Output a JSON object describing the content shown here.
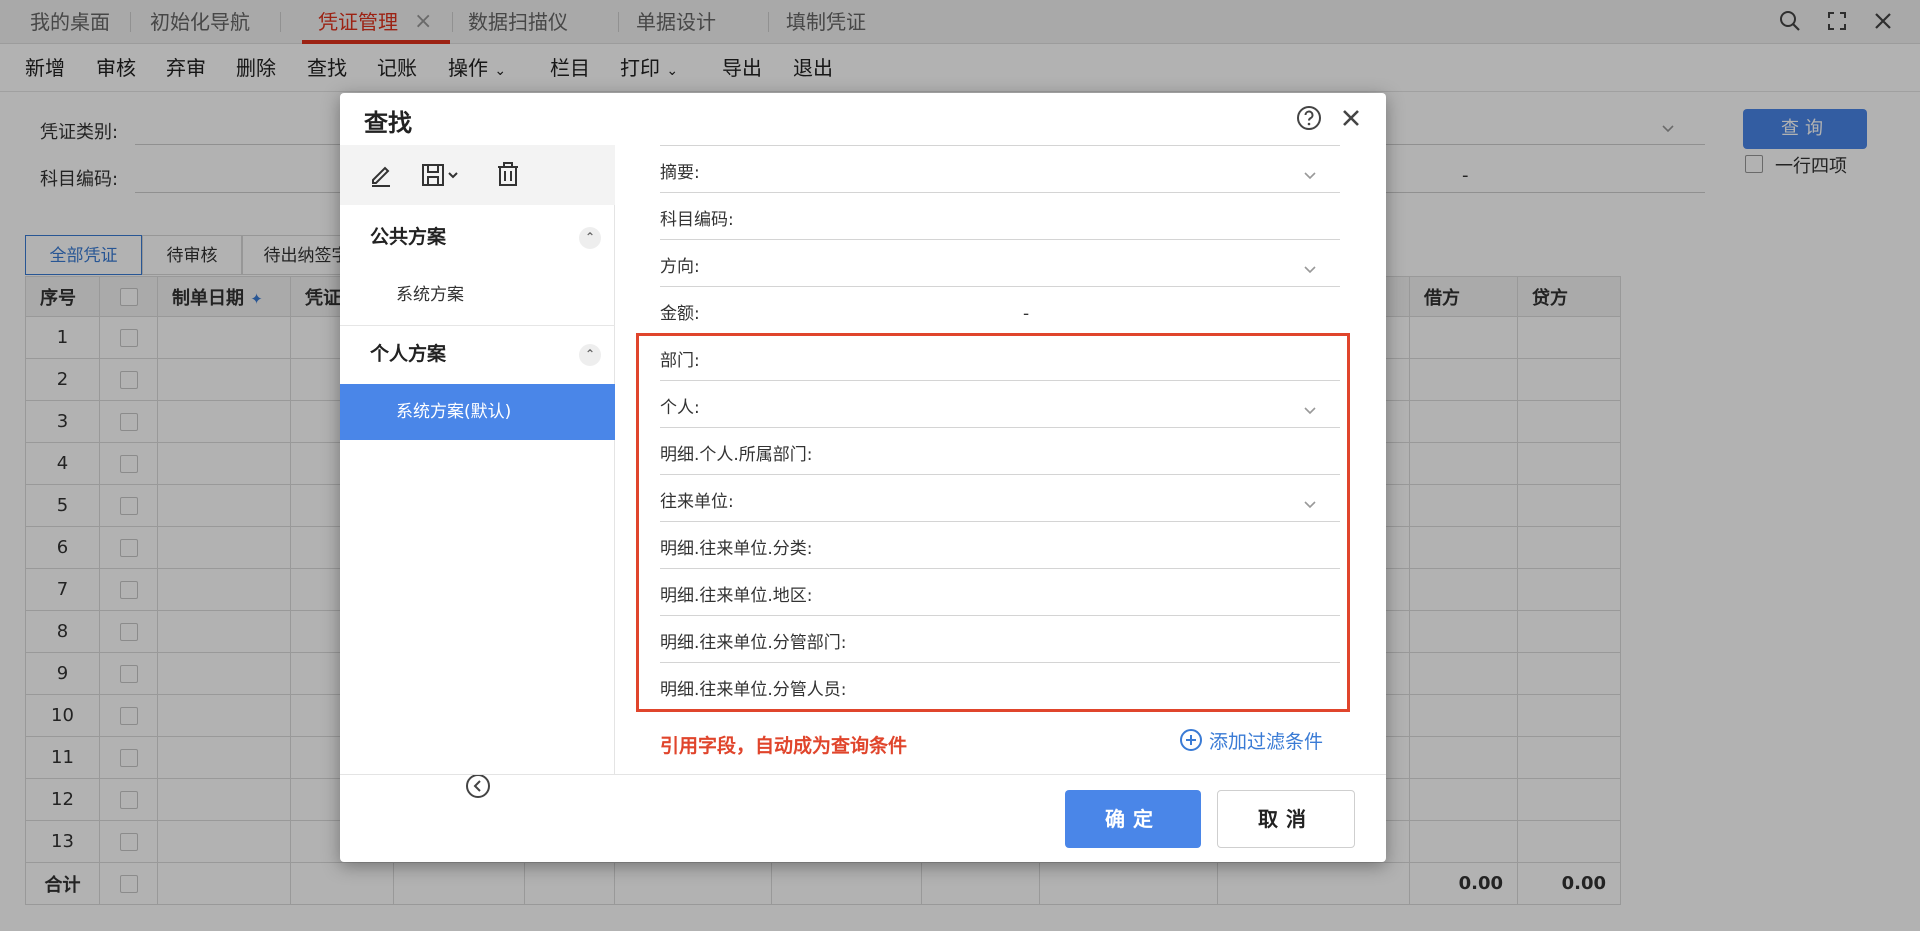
{
  "tabs": [
    {
      "label": "我的桌面"
    },
    {
      "label": "初始化导航"
    },
    {
      "label": "凭证管理"
    },
    {
      "label": "数据扫描仪"
    },
    {
      "label": "单据设计"
    },
    {
      "label": "填制凭证"
    }
  ],
  "toolbar": {
    "items": [
      "新增",
      "审核",
      "弃审",
      "删除",
      "查找",
      "记账",
      "操作",
      "栏目",
      "打印",
      "导出",
      "退出"
    ]
  },
  "filters": {
    "voucher_type_label": "凭证类别:",
    "account_code_label": "科目编码:",
    "range_dash": "-",
    "query_button": "查询",
    "one_row_four_label": "一行四项"
  },
  "view_tabs": [
    "全部凭证",
    "待审核",
    "待出纳签字"
  ],
  "grid": {
    "columns": [
      "序号",
      "",
      "制单日期",
      "凭证",
      "借方",
      "贷方"
    ],
    "rows": [
      "1",
      "2",
      "3",
      "4",
      "5",
      "6",
      "7",
      "8",
      "9",
      "10",
      "11",
      "12",
      "13"
    ],
    "total_label": "合计",
    "total_debit": "0.00",
    "total_credit": "0.00"
  },
  "dialog": {
    "title": "查找",
    "groups": {
      "public": {
        "label": "公共方案",
        "schemes": [
          "系统方案"
        ]
      },
      "personal": {
        "label": "个人方案",
        "schemes": [
          "系统方案(默认)"
        ]
      }
    },
    "fields": [
      {
        "label": "摘要:",
        "dropdown": true
      },
      {
        "label": "科目编码:",
        "dropdown": false
      },
      {
        "label": "方向:",
        "dropdown": true
      },
      {
        "label": "金额:",
        "dropdown": false,
        "range_dash": "-"
      },
      {
        "label": "部门:",
        "dropdown": false
      },
      {
        "label": "个人:",
        "dropdown": true
      },
      {
        "label": "明细.个人.所属部门:",
        "dropdown": false
      },
      {
        "label": "往来单位:",
        "dropdown": true
      },
      {
        "label": "明细.往来单位.分类:",
        "dropdown": false
      },
      {
        "label": "明细.往来单位.地区:",
        "dropdown": false
      },
      {
        "label": "明细.往来单位.分管部门:",
        "dropdown": false
      },
      {
        "label": "明细.往来单位.分管人员:",
        "dropdown": false
      }
    ],
    "note": "引用字段，自动成为查询条件",
    "add_filter": "添加过滤条件",
    "ok_button": "确定",
    "cancel_button": "取消"
  },
  "colors": {
    "accent_blue": "#4a86e8",
    "highlight_red": "#e0452c",
    "active_tab_red": "#e0321c"
  }
}
